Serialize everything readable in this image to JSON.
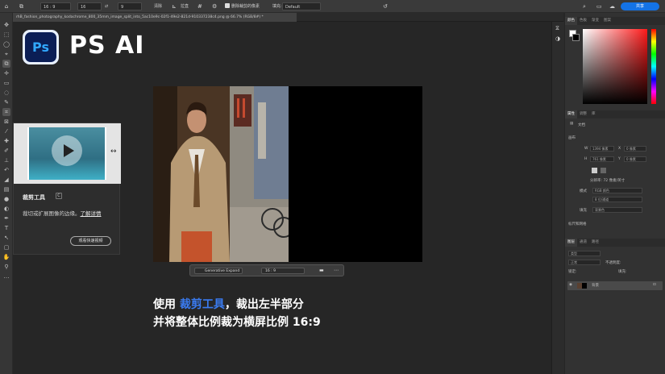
{
  "options_bar": {
    "ratio_value": "16 : 9",
    "width_value": "16",
    "height_value": "9",
    "clear_label": "清除",
    "straighten_label": "拉直",
    "grid_label": "",
    "delete_cropped_label": "删除裁剪的像素",
    "fill_label": "填充:",
    "fill_value": "Default",
    "share_label": "共享"
  },
  "document_tab": {
    "title": "rhB_fashion_photography_kodachrome_800_35mm_image_split_into_5ac10e9c-02f1-49e2-821d-910337238c4.png @ 66.7% (RGB/8#) *"
  },
  "logo": {
    "app_icon_text": "Ps",
    "title": "PS AI"
  },
  "tool_tip": {
    "title": "裁剪工具",
    "badge": "C",
    "description": "裁切或扩展图像的边缘。",
    "learn_more": "了解详情",
    "watch_video": "观看快速视频"
  },
  "context_bar": {
    "generative_expand": "Generative Expand",
    "ratio": "16 : 9"
  },
  "subtitle": {
    "line1_prefix": "使用 ",
    "line1_highlight": "裁剪工具",
    "line1_suffix": "，裁出左半部分",
    "line2": "并将整体比例裁为横屏比例 16:9"
  },
  "panels": {
    "color_tabs": [
      "颜色",
      "色板",
      "渐变",
      "图案"
    ],
    "properties_tabs": [
      "属性",
      "调整",
      "库"
    ],
    "document_label": "文档",
    "canvas_section": "画布",
    "w_label": "W",
    "w_value": "1394 像素",
    "x_label": "X",
    "x_value": "0 像素",
    "h_label": "H",
    "h_value": "761 像素",
    "y_label": "Y",
    "y_value": "0 像素",
    "resolution": "分辨率: 72 像素/英寸",
    "mode_label": "模式",
    "mode_value": "RGB 颜色",
    "depth_value": "8 位/通道",
    "fill_label": "填充",
    "fill_value": "背景色",
    "rulers_section": "标尺和网格",
    "layers_tabs": [
      "图层",
      "通道",
      "路径"
    ],
    "layer_kind": "类型",
    "layer_blend": "正常",
    "layer_opacity": "不透明度:",
    "layer_lock": "锁定:",
    "layer_fill": "填充:",
    "layer_name": "背景"
  },
  "colors": {
    "accent_blue": "#1473e6",
    "highlight_blue": "#3a7bf0",
    "ps_icon_bg": "#0b1e55",
    "ps_icon_text": "#31a8ff"
  }
}
